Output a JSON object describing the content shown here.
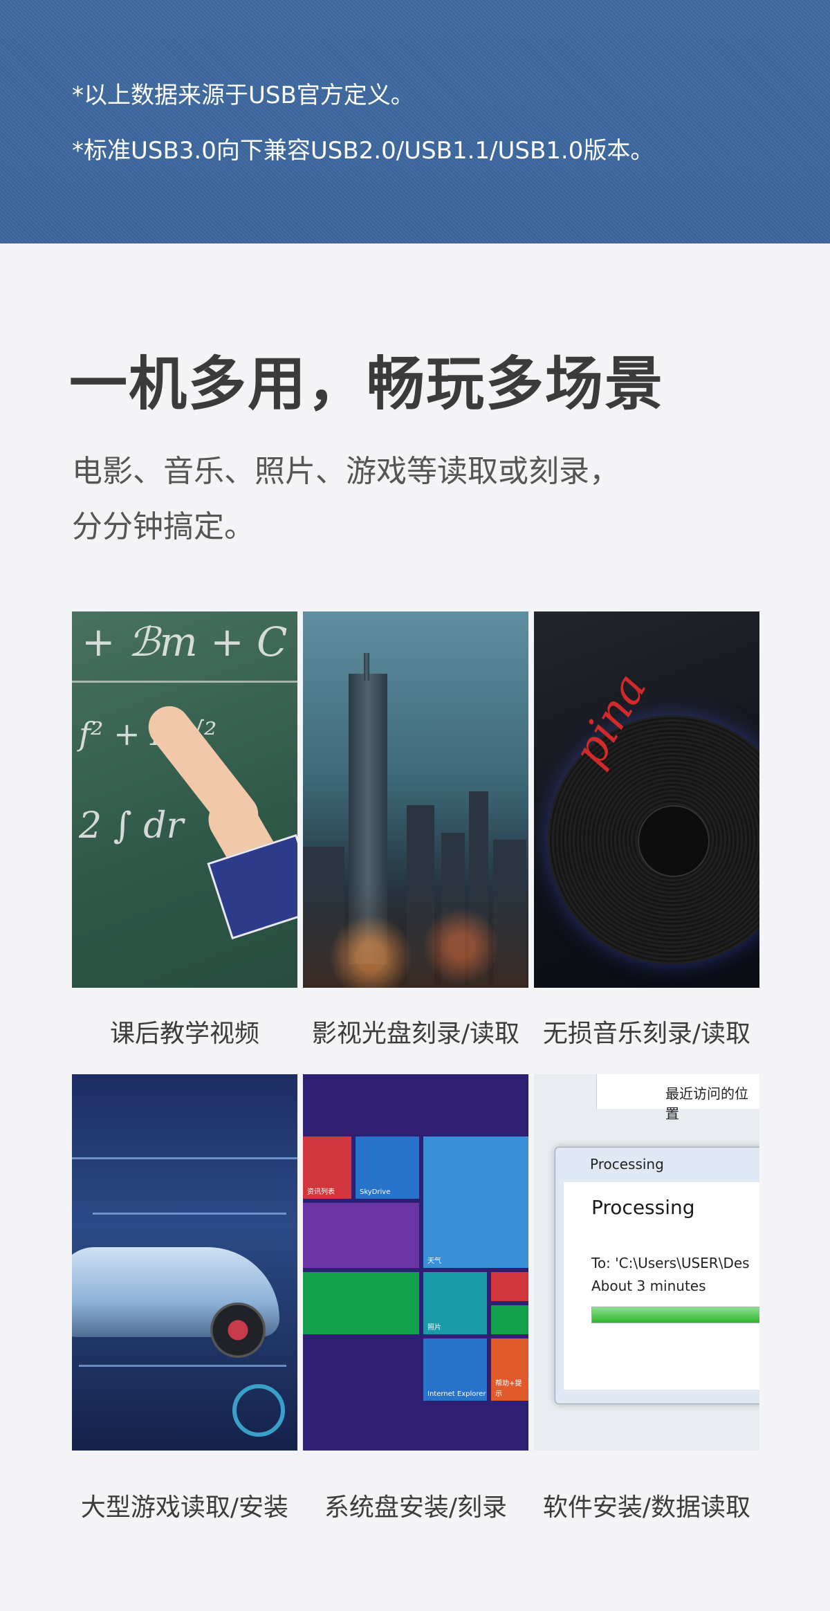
{
  "notes": {
    "line1": "*以上数据来源于USB官方定义。",
    "line2": "*标准USB3.0向下兼容USB2.0/USB1.1/USB1.0版本。"
  },
  "headline": "一机多用，畅玩多场景",
  "subtitle": {
    "line1": "电影、音乐、照片、游戏等读取或刻录，",
    "line2": "分分钟搞定。"
  },
  "scenes": [
    {
      "caption": "课后教学视频"
    },
    {
      "caption": "影视光盘刻录/读取"
    },
    {
      "caption": "无损音乐刻录/读取"
    },
    {
      "caption": "大型游戏读取/安装"
    },
    {
      "caption": "系统盘安装/刻录"
    },
    {
      "caption": "软件安装/数据读取"
    }
  ],
  "images": {
    "vinyl_text": "pina",
    "win_tiles": {
      "skydrive": "SkyDrive",
      "weather": "天气",
      "photos": "照片",
      "ie": "Internet Explorer",
      "help": "帮助+提示",
      "people": "资讯列表"
    },
    "dialog": {
      "explorer_text": "最近访问的位置",
      "window_title": "Processing",
      "heading": "Processing",
      "to_line": "To: 'C:\\Users\\USER\\Des",
      "eta": "About 3 minutes",
      "progress": 0.95
    }
  },
  "colors": {
    "band": "#3f6aa1",
    "page_bg": "#f4f4f6"
  }
}
